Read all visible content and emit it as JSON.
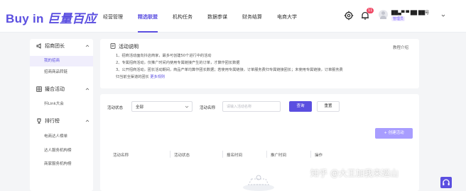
{
  "app": {
    "logo_main": "Buy in",
    "logo_sub": "巨量百应"
  },
  "nav": {
    "items": [
      {
        "label": "经营管理"
      },
      {
        "label": "精选联盟"
      },
      {
        "label": "机构任务"
      },
      {
        "label": "数据参谋"
      },
      {
        "label": "财务结算"
      },
      {
        "label": "电商大学"
      }
    ],
    "active_index": 1
  },
  "header": {
    "notification_count": "11",
    "user_name": "██▄▀ ▀ ██ ██号",
    "user_role": "管理员",
    "icons": [
      "settings-icon",
      "bell-icon",
      "avatar",
      "chevron-down-icon"
    ]
  },
  "sidebar": {
    "groups": [
      {
        "label": "招商团长",
        "icon": "megaphone-icon",
        "subitems": [
          "我的招商",
          "招商商品转链"
        ]
      },
      {
        "label": "撮合活动",
        "icon": "grid-icon",
        "subitems": [
          "抖Link大会"
        ]
      },
      {
        "label": "排行榜",
        "icon": "trophy-icon",
        "subitems": [
          "电商达人榜单",
          "达人服务机构榜",
          "商家服务机构榜"
        ]
      }
    ],
    "active_subitem": "我的招商"
  },
  "info_card": {
    "title": "活动说明",
    "help_link": "教程介绍",
    "lines": [
      "1、招商活动面向抖店商家，最多可创建50个进行中的活动",
      "2、专属招商活动，仅推广时间内使用专属链接产生的订单，才算作团长数据",
      "3、公开招商活动，团长活动期间，商品产单均算作团长数据；若使用专属链接，订单服务费归专属链接团长；未使用专属链接，订单服务费",
      "归当前全渠道的团长"
    ],
    "more_rules": "更多规则"
  },
  "filter": {
    "status_label": "活动状态",
    "status_value": "全部",
    "name_label": "活动名称",
    "name_placeholder": "请输入活动名称",
    "query_button": "查询",
    "reset_button": "重置"
  },
  "create_button": "+ 创建活动",
  "table": {
    "columns": [
      "活动名称",
      "活动状态",
      "报名时间",
      "推广时间",
      "操作"
    ]
  },
  "watermark": "知乎 @大王加我来巡山",
  "colors": {
    "primary": "#5b4fe0",
    "primary_light": "#a89dff",
    "badge": "#f04864",
    "background": "#f4f5f7"
  }
}
